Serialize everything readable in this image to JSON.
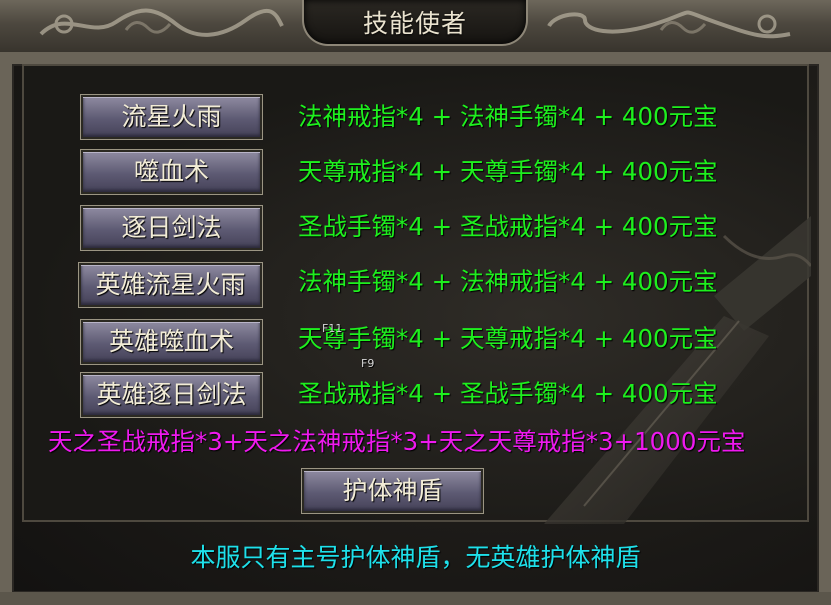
{
  "window": {
    "title": "技能使者"
  },
  "skills": [
    {
      "label": "流星火雨",
      "recipe": "法神戒指*4 + 法神手镯*4 + 400元宝"
    },
    {
      "label": "噬血术",
      "recipe": "天尊戒指*4 + 天尊手镯*4 + 400元宝"
    },
    {
      "label": "逐日剑法",
      "recipe": "圣战手镯*4 + 圣战戒指*4 + 400元宝"
    },
    {
      "label": "英雄流星火雨",
      "recipe": "法神手镯*4 + 法神戒指*4 + 400元宝"
    },
    {
      "label": "英雄噬血术",
      "recipe": "天尊手镯*4 + 天尊戒指*4 + 400元宝"
    },
    {
      "label": "英雄逐日剑法",
      "recipe": "圣战戒指*4 + 圣战手镯*4 + 400元宝"
    }
  ],
  "shield": {
    "recipe": "天之圣战戒指*3+天之法神戒指*3+天之天尊戒指*3+1000元宝",
    "button_label": "护体神盾"
  },
  "notice": "本服只有主号护体神盾，无英雄护体神盾",
  "hotkeys": [
    "F11",
    "F9"
  ],
  "colors": {
    "recipe": "#1ef01e",
    "combo": "#ef19ef",
    "notice": "#1ee0ea",
    "button": "#6a6780"
  }
}
